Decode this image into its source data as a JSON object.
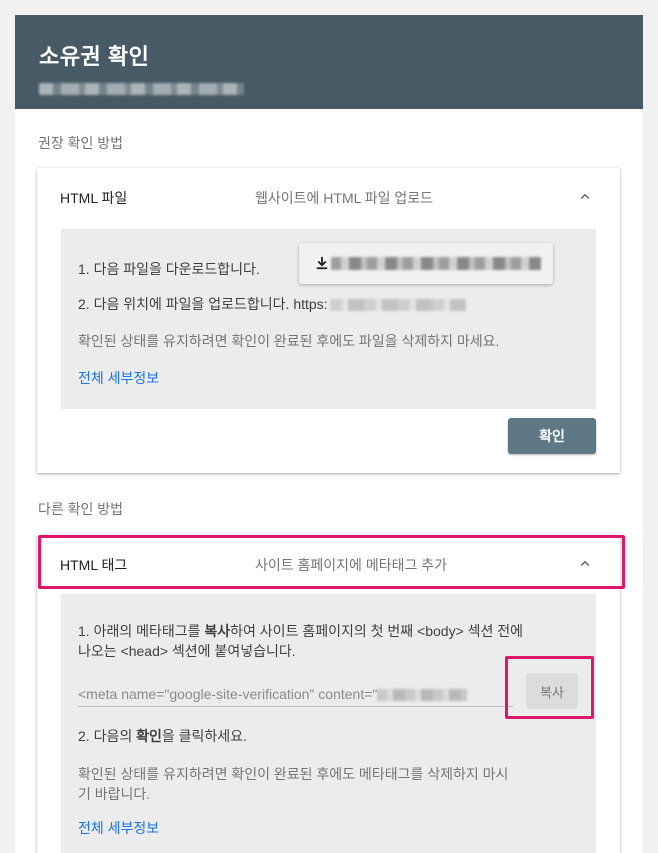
{
  "header": {
    "title": "소유권 확인"
  },
  "recommended": {
    "label": "권장 확인 방법",
    "card": {
      "name": "HTML 파일",
      "description": "웹사이트에 HTML 파일 업로드",
      "step1": "1. 다음 파일을 다운로드합니다.",
      "step2_prefix": "2. 다음 위치에 파일을 업로드합니다. https:",
      "note": "확인된 상태를 유지하려면 확인이 완료된 후에도 파일을 삭제하지 마세요.",
      "details_link": "전체 세부정보",
      "confirm_button": "확인",
      "download_icon": "download-icon",
      "chevron_icon": "chevron-up-icon"
    }
  },
  "other": {
    "label": "다른 확인 방법",
    "card": {
      "name": "HTML 태그",
      "description": "사이트 홈페이지에 메타태그 추가",
      "step1_a": "1. 아래의 메타태그를 ",
      "step1_bold": "복사",
      "step1_b": "하여 사이트 홈페이지의 첫 번째 <body> 섹션 전에",
      "step1_line2": "나오는 <head> 섹션에 붙여넣습니다.",
      "meta_value": "<meta name=\"google-site-verification\" content=\"",
      "copy_button": "복사",
      "step2_a": "2. 다음의 ",
      "step2_bold": "확인",
      "step2_b": "을 클릭하세요.",
      "note_line1": "확인된 상태를 유지하려면 확인이 완료된 후에도 메타태그를 삭제하지 마시",
      "note_line2": "기 바랍니다.",
      "details_link": "전체 세부정보",
      "chevron_icon": "chevron-up-icon"
    }
  },
  "colors": {
    "header_bg": "#475a66",
    "confirm_btn": "#5f7886",
    "highlight": "#e0166d",
    "link": "#1a73e8"
  }
}
